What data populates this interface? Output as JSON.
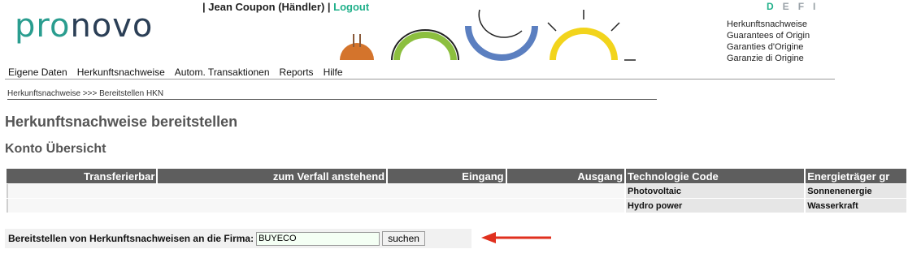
{
  "logo": {
    "text_a": "pro",
    "text_b": "novo"
  },
  "user": {
    "sep1": "|",
    "name": "Jean Coupon (Händler)",
    "sep2": "|",
    "logout": "Logout"
  },
  "languages": [
    "D",
    "E",
    "F",
    "I"
  ],
  "active_language": "D",
  "taglines": [
    "Herkunftsnachweise",
    "Guarantees of Origin",
    "Garanties d'Origine",
    "Garanzie di Origine"
  ],
  "nav": [
    "Eigene Daten",
    "Herkunftsnachweise",
    "Autom. Transaktionen",
    "Reports",
    "Hilfe"
  ],
  "breadcrumb": {
    "root": "Herkunftsnachweise",
    "sep": ">>>",
    "current": "Bereitstellen HKN"
  },
  "page_title": "Herkunftsnachweise bereitstellen",
  "section_title": "Konto Übersicht",
  "table": {
    "headers": [
      "Transferierbar",
      "zum Verfall anstehend",
      "Eingang",
      "Ausgang",
      "Technologie Code",
      "Energieträger gr"
    ],
    "rows": [
      {
        "technology": "Photovoltaic",
        "energy": "Sonnenenergie"
      },
      {
        "technology": "Hydro power",
        "energy": "Wasserkraft"
      }
    ]
  },
  "form": {
    "label": "Bereitstellen von Herkunftsnachweisen an die Firma:",
    "company_value": "BUYECO",
    "search_button": "suchen"
  },
  "colors": {
    "brand_green": "#20b08a",
    "header_gray": "#5e5e5e",
    "arrow_red": "#e0301e",
    "arc_orange": "#d4742c",
    "arc_green": "#8cbf3f",
    "arc_blue": "#5b7fc0",
    "arc_yellow": "#f2d41c"
  }
}
